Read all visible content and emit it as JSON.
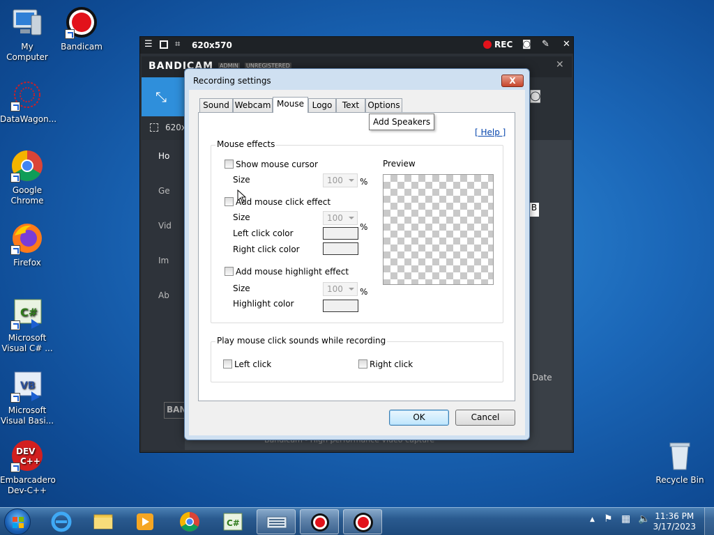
{
  "desktop": {
    "icons": [
      {
        "label": "My Computer"
      },
      {
        "label": "Bandicam"
      },
      {
        "label": "DataWagon..."
      },
      {
        "label": "Google Chrome"
      },
      {
        "label": "Firefox"
      },
      {
        "label": "Microsoft Visual C# ..."
      },
      {
        "label": "Microsoft Visual Basi..."
      },
      {
        "label": "Embarcadero Dev-C++"
      },
      {
        "label": "Recycle Bin"
      }
    ]
  },
  "bandicam": {
    "size_label": "620x570",
    "rec_label": "REC",
    "brand": "BANDICAM",
    "badge_admin": "ADMIN",
    "badge_unreg": "UNREGISTERED",
    "target_label": "620x5",
    "nav": [
      "Ho",
      "Ge",
      "Vid",
      "Im",
      "Ab"
    ],
    "date_label": "Date",
    "footer_text": "Bandicam - High performance video capture",
    "bottom_brand": "BAN",
    "side_text": "B"
  },
  "dialog": {
    "title": "Recording settings",
    "close": "X",
    "tabs": [
      "Sound",
      "Webcam",
      "Mouse",
      "Logo",
      "Text",
      "Options"
    ],
    "selected_tab": "Mouse",
    "tooltip": "Add Speakers",
    "help": "[ Help ]",
    "mouse_effects": {
      "title": "Mouse effects",
      "show_cursor": "Show mouse cursor",
      "size_label": "Size",
      "cursor_size": "100",
      "percent": "%",
      "click_effect": "Add mouse click effect",
      "click_size": "100",
      "left_click_color": "Left click color",
      "right_click_color": "Right click color",
      "highlight_effect": "Add mouse highlight effect",
      "highlight_size": "100",
      "highlight_color": "Highlight color",
      "preview": "Preview"
    },
    "sounds": {
      "title": "Play mouse click sounds while recording",
      "left": "Left click",
      "right": "Right click"
    },
    "ok": "OK",
    "cancel": "Cancel"
  },
  "taskbar": {
    "time": "11:36 PM",
    "date": "3/17/2023"
  }
}
